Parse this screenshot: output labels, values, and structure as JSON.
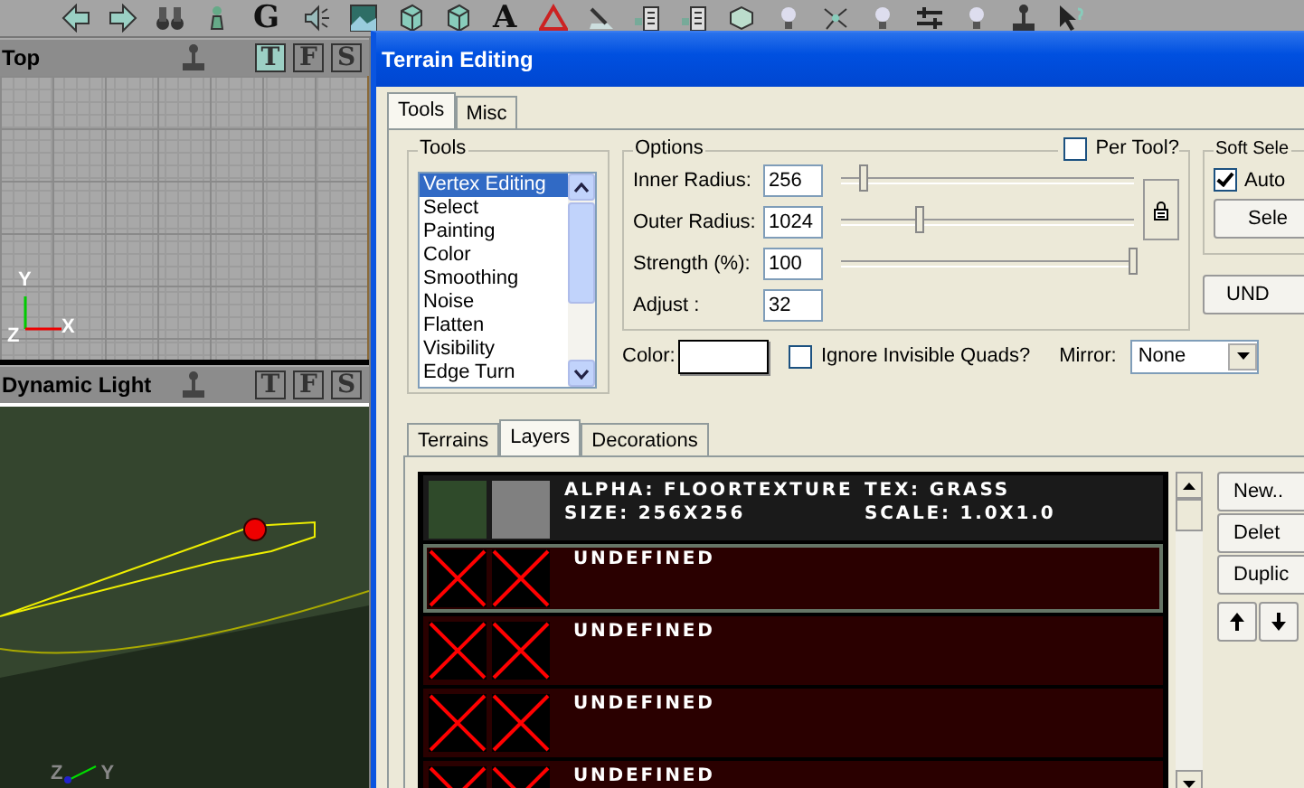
{
  "toolbar": [
    {
      "kind": "back"
    },
    {
      "kind": "forward"
    },
    {
      "kind": "binoculars"
    },
    {
      "kind": "pawn"
    },
    {
      "kind": "glyph",
      "text": "G"
    },
    {
      "kind": "speaker"
    },
    {
      "kind": "picture"
    },
    {
      "kind": "cube"
    },
    {
      "kind": "cube"
    },
    {
      "kind": "glyph",
      "text": "A"
    },
    {
      "kind": "triangle"
    },
    {
      "kind": "brush"
    },
    {
      "kind": "meter"
    },
    {
      "kind": "meter"
    },
    {
      "kind": "box"
    },
    {
      "kind": "bulb"
    },
    {
      "kind": "nodes"
    },
    {
      "kind": "bulb"
    },
    {
      "kind": "sliders"
    },
    {
      "kind": "bulb"
    },
    {
      "kind": "joystick"
    },
    {
      "kind": "cursor"
    }
  ],
  "viewports": [
    {
      "title": "Top",
      "kind": "grid",
      "buttons": [
        {
          "label": "T",
          "selected": true
        },
        {
          "label": "F",
          "selected": false
        },
        {
          "label": "S",
          "selected": false
        }
      ],
      "axes": [
        "Y",
        "X",
        "Z"
      ]
    },
    {
      "title": "Dynamic Light",
      "kind": "scene",
      "buttons": [
        {
          "label": "T",
          "selected": false
        },
        {
          "label": "F",
          "selected": false
        },
        {
          "label": "S",
          "selected": false
        }
      ],
      "axes": [
        "Z",
        "Y"
      ]
    }
  ],
  "dialog": {
    "title": "Terrain Editing",
    "tabs": [
      {
        "label": "Tools",
        "selected": true
      },
      {
        "label": "Misc",
        "selected": false
      }
    ],
    "tools_group": {
      "title": "Tools",
      "items": [
        {
          "label": "Vertex Editing",
          "selected": true
        },
        {
          "label": "Select",
          "selected": false
        },
        {
          "label": "Painting",
          "selected": false
        },
        {
          "label": "Color",
          "selected": false
        },
        {
          "label": "Smoothing",
          "selected": false
        },
        {
          "label": "Noise",
          "selected": false
        },
        {
          "label": "Flatten",
          "selected": false
        },
        {
          "label": "Visibility",
          "selected": false
        },
        {
          "label": "Edge Turn",
          "selected": false
        }
      ]
    },
    "options_group": {
      "title": "Options",
      "per_tool": {
        "label": "Per Tool?",
        "checked": false
      },
      "fields": [
        {
          "label": "Inner Radius:",
          "value": "256",
          "level": 0.08
        },
        {
          "label": "Outer Radius:",
          "value": "1024",
          "level": 0.27
        },
        {
          "label": "Strength (%):",
          "value": "100",
          "level": 1.0
        },
        {
          "label": "Adjust :",
          "value": "32"
        }
      ]
    },
    "soft_selection": {
      "title": "Soft Sele",
      "checkbox": {
        "label": "Auto",
        "checked": true
      },
      "button": "Sele"
    },
    "undo_button": "UND",
    "color_label": "Color:",
    "ignore_quads": {
      "label": "Ignore Invisible Quads?",
      "checked": false
    },
    "mirror": {
      "label": "Mirror:",
      "value": "None"
    },
    "subtabs": [
      {
        "label": "Terrains",
        "selected": false
      },
      {
        "label": "Layers",
        "selected": true
      },
      {
        "label": "Decorations",
        "selected": false
      }
    ],
    "layers": [
      {
        "kind": "texture",
        "selected": false,
        "alpha": "ALPHA: FLOORTEXTURE",
        "texture_name": "TEX: GRASS",
        "size": "SIZE: 256X256",
        "scale": "SCALE: 1.0X1.0"
      },
      {
        "kind": "undefined",
        "selected": true,
        "label": "UNDEFINED"
      },
      {
        "kind": "undefined",
        "selected": false,
        "label": "UNDEFINED"
      },
      {
        "kind": "undefined",
        "selected": false,
        "label": "UNDEFINED"
      },
      {
        "kind": "undefined",
        "selected": false,
        "label": "UNDEFINED"
      }
    ],
    "layer_buttons": [
      "New..",
      "Delet",
      "Duplic"
    ]
  }
}
